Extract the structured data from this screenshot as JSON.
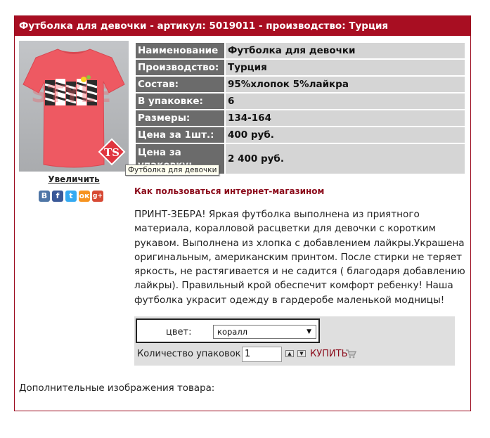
{
  "header": {
    "title": "Футболка для девочки - артикул: 5019011 - производство: Турция"
  },
  "product_image": {
    "alt": "Футболка для девочки",
    "print_text": "STYLE",
    "logo_text": "TS"
  },
  "enlarge_link": "Увеличить",
  "tooltip": "Футболка для девочки",
  "social": [
    {
      "name": "vkontakte-icon",
      "glyph": "В"
    },
    {
      "name": "facebook-icon",
      "glyph": "f"
    },
    {
      "name": "twitter-icon",
      "glyph": "t"
    },
    {
      "name": "odnoklassniki-icon",
      "glyph": "ок"
    },
    {
      "name": "google-plus-icon",
      "glyph": "g+"
    }
  ],
  "specs": [
    {
      "key": "Наименование",
      "value": "Футболка для девочки"
    },
    {
      "key": "Производство:",
      "value": "Турция"
    },
    {
      "key": "Состав:",
      "value": "95%хлопок 5%лайкра"
    },
    {
      "key": "В упаковке:",
      "value": "6"
    },
    {
      "key": "Размеры:",
      "value": "134-164"
    },
    {
      "key": "Цена за 1шт.:",
      "value": "400 руб."
    },
    {
      "key": "Цена за упаковку:",
      "value": "2 400 руб."
    }
  ],
  "how_to_link": "Как пользоваться интернет-магазином",
  "description": "ПРИНТ-ЗЕБРА! Яркая футболка выполнена из приятного  материала, коралловой расцветки для девочки с коротким рукавом. Выполнена из хлопка с добавлением лайкры.Украшена оригинальным, американским принтом. После стирки не теряет яркость, не растягивается и не садится ( благодаря добавлению лайкры). Правильный крой обеспечит комфорт ребенку! Наша футболка  украсит одежду в гардеробе маленькой модницы!",
  "order": {
    "color_label": "цвет:",
    "color_value": "коралл",
    "qty_label": "Количество упаковок:",
    "qty_value": "1",
    "buy_label": "КУПИТЬ"
  },
  "additional_images_label": "Дополнительные изображения товара:",
  "colors": {
    "brand_red": "#a80e22",
    "link_red": "#8b0a1a",
    "spec_key_bg": "#6b6b6b",
    "spec_value_bg": "#d5d5d5",
    "tshirt": "#ee5962"
  }
}
